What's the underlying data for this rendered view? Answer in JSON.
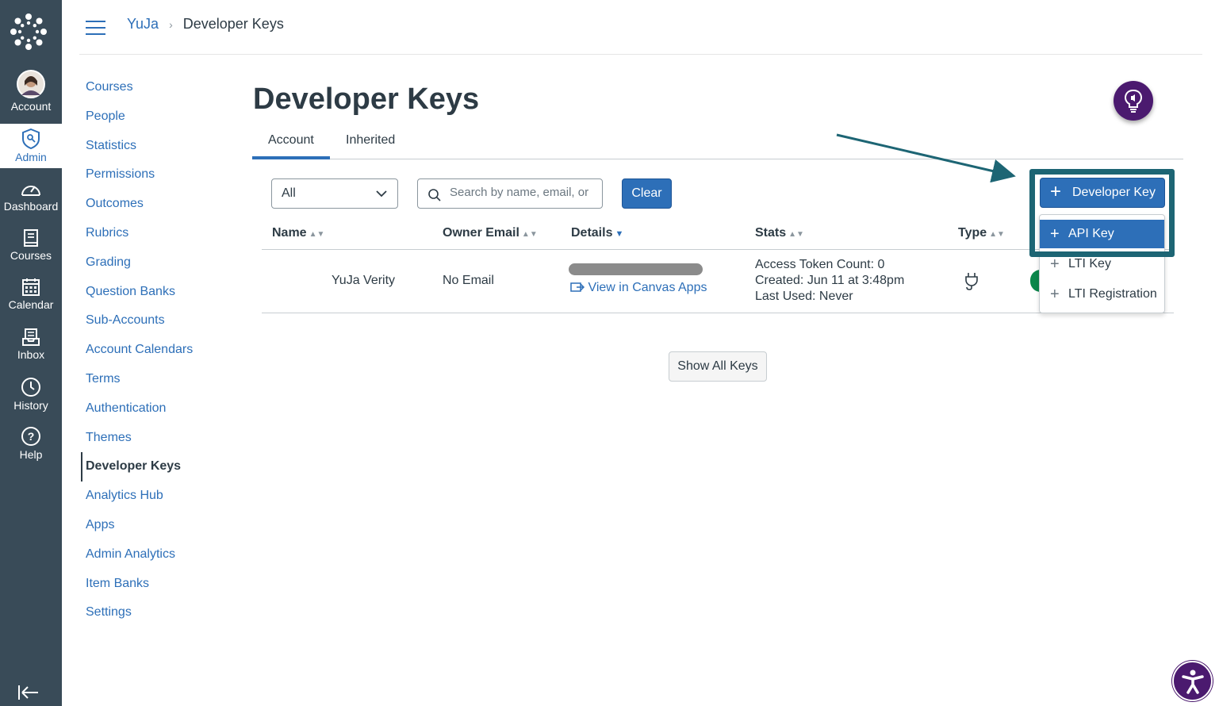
{
  "global_nav": {
    "account": "Account",
    "admin": "Admin",
    "dashboard": "Dashboard",
    "courses": "Courses",
    "calendar": "Calendar",
    "inbox": "Inbox",
    "history": "History",
    "help": "Help"
  },
  "breadcrumb": {
    "root": "YuJa",
    "current": "Developer Keys"
  },
  "sub_nav": [
    "Courses",
    "People",
    "Statistics",
    "Permissions",
    "Outcomes",
    "Rubrics",
    "Grading",
    "Question Banks",
    "Sub-Accounts",
    "Account Calendars",
    "Terms",
    "Authentication",
    "Themes",
    "Developer Keys",
    "Analytics Hub",
    "Apps",
    "Admin Analytics",
    "Item Banks",
    "Settings"
  ],
  "page_title": "Developer Keys",
  "tabs": {
    "account": "Account",
    "inherited": "Inherited"
  },
  "filter": {
    "selected": "All",
    "search_placeholder": "Search by name, email, or",
    "clear": "Clear"
  },
  "table": {
    "headers": {
      "name": "Name",
      "owner_email": "Owner Email",
      "details": "Details",
      "stats": "Stats",
      "type": "Type"
    },
    "row": {
      "name": "YuJa Verity",
      "owner_email": "No Email",
      "details_link": "View in Canvas Apps",
      "stats": [
        "Access Token Count: 0",
        "Created: Jun 11 at 3:48pm",
        "Last Used: Never"
      ]
    }
  },
  "show_all": "Show All Keys",
  "developer_key_button": "Developer Key",
  "dropdown": [
    "API Key",
    "LTI Key",
    "LTI Registration"
  ],
  "colors": {
    "nav_bg": "#394b58",
    "brand_blue": "#2d6fb8",
    "highlight": "#1d6574",
    "purple": "#4b1a6f"
  }
}
